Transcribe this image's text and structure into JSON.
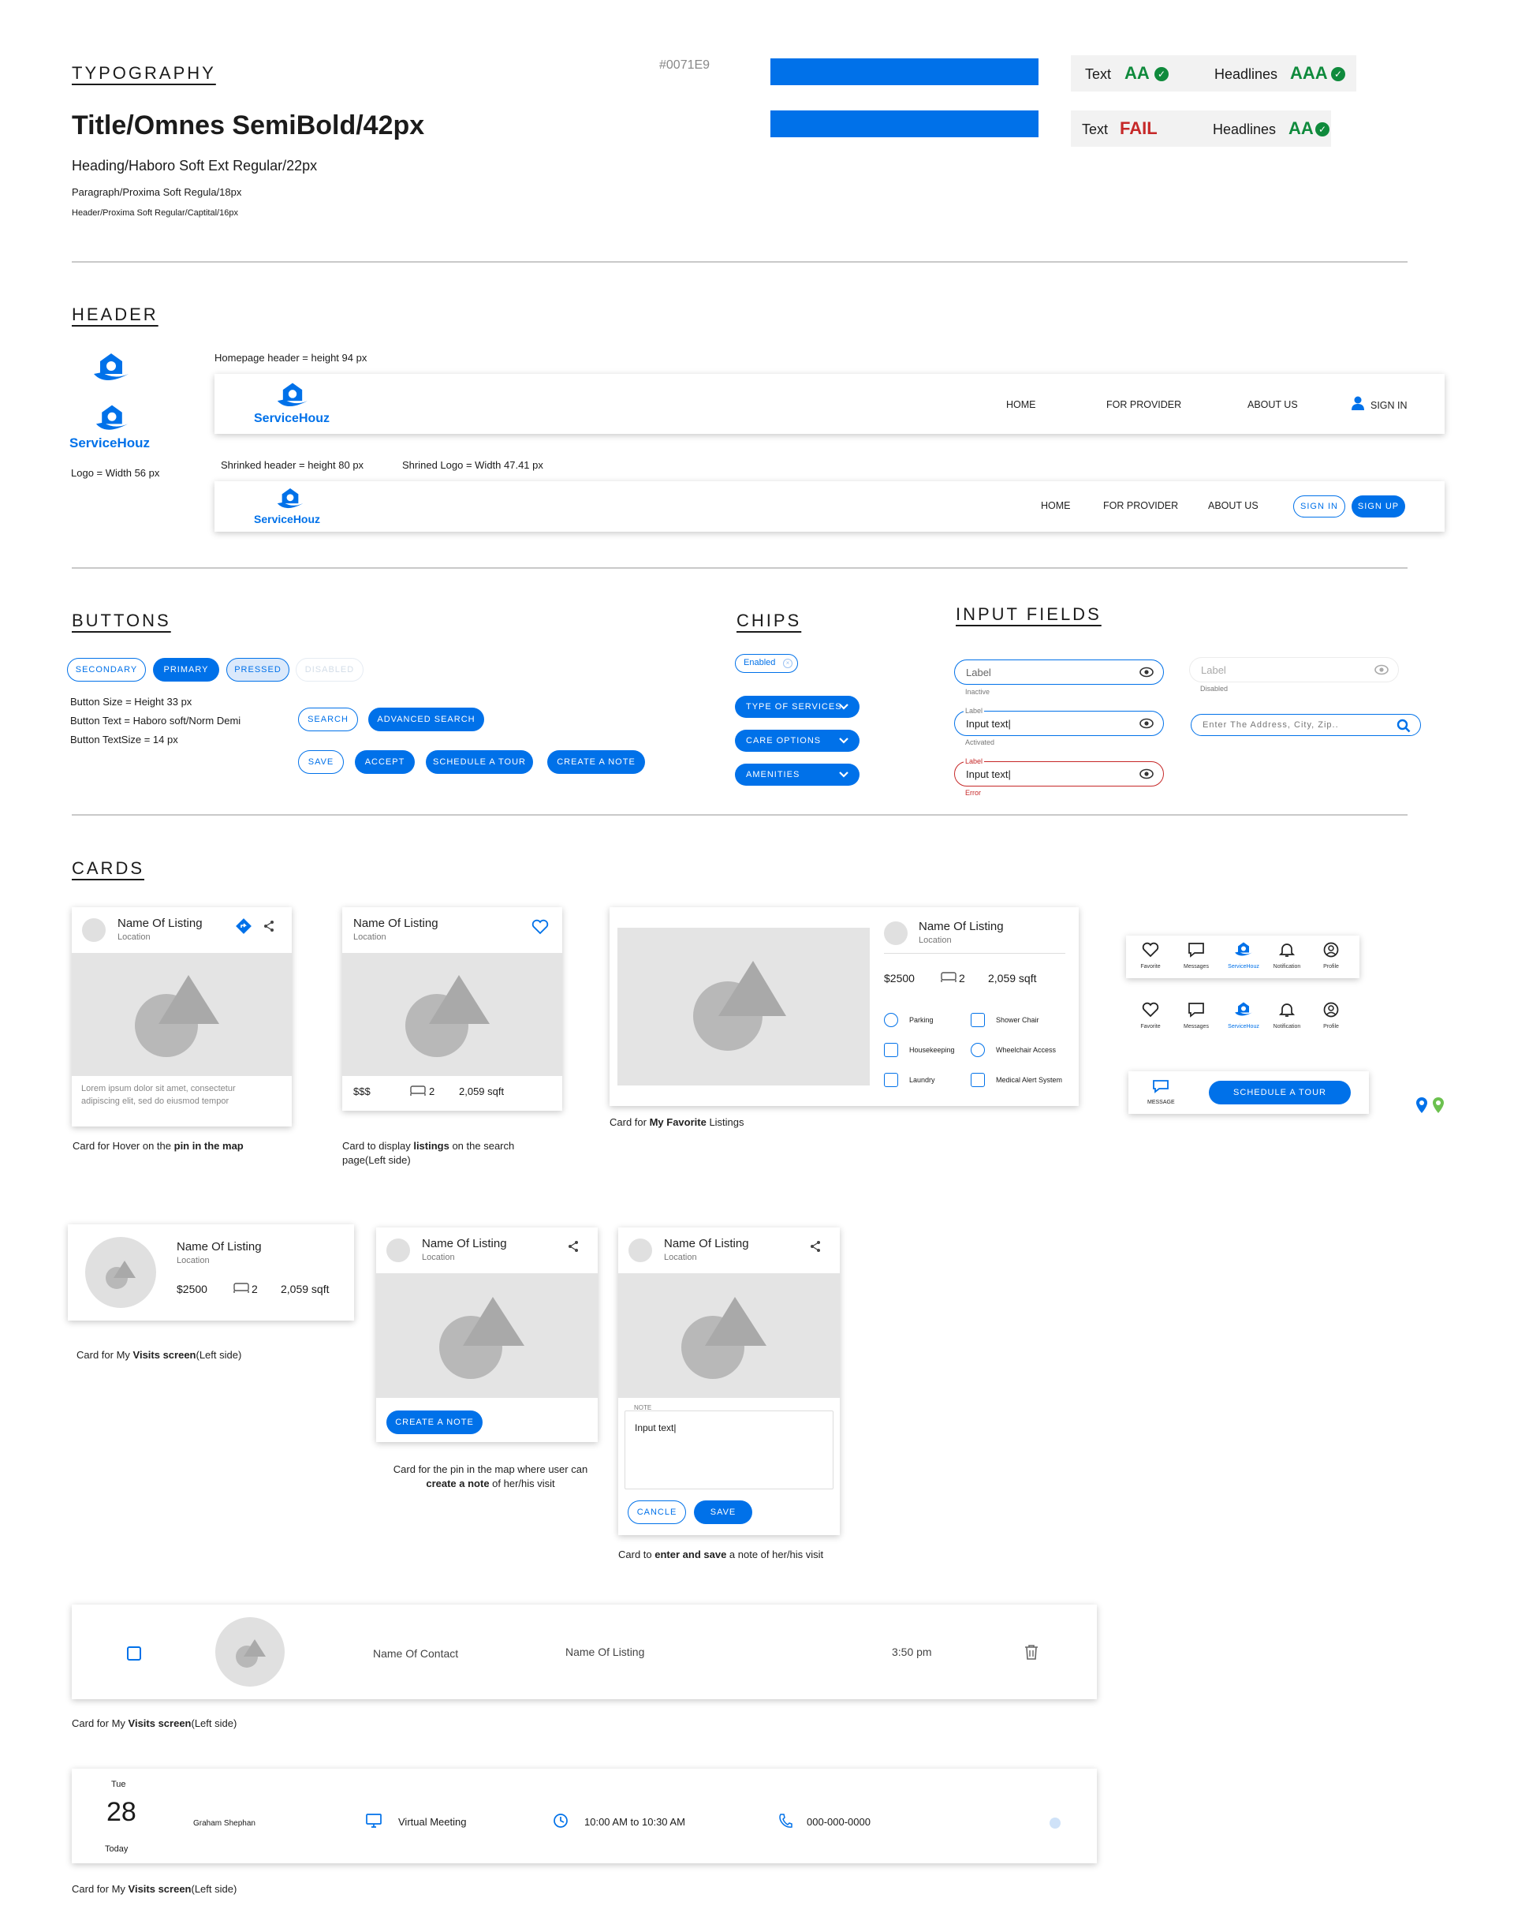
{
  "typography": {
    "section": "TYPOGRAPHY",
    "title": "Title/Omnes SemiBold/42px",
    "heading": "Heading/Haboro Soft Ext Regular/22px",
    "paragraph": "Paragraph/Proxima Soft Regula/18px",
    "header": "Header/Proxima Soft Regular/Captital/16px",
    "swatch_hex": "#0071E9",
    "contrast": [
      {
        "text_label": "Text",
        "text_grade": "AA",
        "head_label": "Headlines",
        "head_grade": "AAA"
      },
      {
        "text_label": "Text",
        "text_grade": "FAIL",
        "head_label": "Headlines",
        "head_grade": "AA"
      }
    ]
  },
  "colors": {
    "primary": "#0071E9",
    "pass": "#0f8a3c",
    "fail": "#c62828"
  },
  "header": {
    "section": "HEADER",
    "brand": "ServiceHouz",
    "logo_note": "Logo = Width 56 px",
    "homepage_note": "Homepage header = height 94 px",
    "shrinked_note": "Shrinked header = height 80 px",
    "shrined_logo_note": "Shrined Logo = Width 47.41 px",
    "nav": [
      "HOME",
      "FOR PROVIDER",
      "ABOUT US"
    ],
    "sign_in": "SIGN IN",
    "sign_up": "SIGN UP"
  },
  "buttons": {
    "section": "BUTTONS",
    "secondary": "SECONDARY",
    "primary": "PRIMARY",
    "pressed": "PRESSED",
    "disabled": "DISABLED",
    "notes": [
      "Button Size = Height 33 px",
      "Button Text =  Haboro soft/Norm Demi",
      "Button TextSize =  14 px"
    ],
    "search": "SEARCH",
    "advanced_search": "ADVANCED SEARCH",
    "save": "SAVE",
    "accept": "ACCEPT",
    "schedule": "SCHEDULE A TOUR",
    "create_note": "CREATE A NOTE"
  },
  "chips": {
    "section": "CHIPS",
    "enabled": "Enabled",
    "items": [
      "TYPE OF SERVICES",
      "CARE OPTIONS",
      "AMENITIES"
    ]
  },
  "inputs": {
    "section": "INPUT FIELDS",
    "label": "Label",
    "inactive": "Inactive",
    "activated": "Activated",
    "error": "Error",
    "disabled": "Disabled",
    "input_text": "Input text",
    "address_placeholder": "Enter The Address, City, Zip.."
  },
  "cards": {
    "section": "CARDS",
    "listing_name": "Name Of Listing",
    "location": "Location",
    "lorem": "Lorem ipsum dolor sit amet, consectetur adipiscing elit, sed do eiusmod tempor",
    "price_sym": "$$$",
    "price": "$2500",
    "beds": "2",
    "sqft": "2,059 sqft",
    "amenities": [
      "Parking",
      "Shower Chair",
      "Housekeeping",
      "Wheelchair Access",
      "Laundry",
      "Medical Alert System"
    ],
    "nav_icons": [
      "Favorite",
      "Messages",
      "ServiceHouz",
      "Notification",
      "Profile"
    ],
    "message": "MESSAGE",
    "schedule": "SCHEDULE A TOUR",
    "create_note": "CREATE A NOTE",
    "note_label": "NOTE",
    "note_text": "Input text",
    "cancle": "CANCLE",
    "save": "SAVE",
    "contact": "Name Of Contact",
    "time": "3:50 pm",
    "day": "Tue",
    "date": "28",
    "today": "Today",
    "person": "Graham Shephan",
    "meeting": "Virtual Meeting",
    "slot": "10:00 AM to 10:30 AM",
    "phone": "000-000-0000",
    "captions": {
      "hover_a": "Card for Hover on the ",
      "hover_b": "pin in the map",
      "search_a": "Card to display ",
      "search_b": "listings",
      "search_c": " on the search",
      "search_d": "page(Left side)",
      "fav_a": "Card for ",
      "fav_b": "My Favorite",
      "fav_c": " Listings",
      "visits_a": "Card for My ",
      "visits_b": "Visits screen",
      "visits_c": "(Left side)",
      "pin_a": "Card for the pin in the map where user can",
      "pin_b": "create a note",
      "pin_c": " of her/his visit",
      "enter_a": "Card to ",
      "enter_b": "enter and save",
      "enter_c": " a note of her/his visit"
    }
  }
}
